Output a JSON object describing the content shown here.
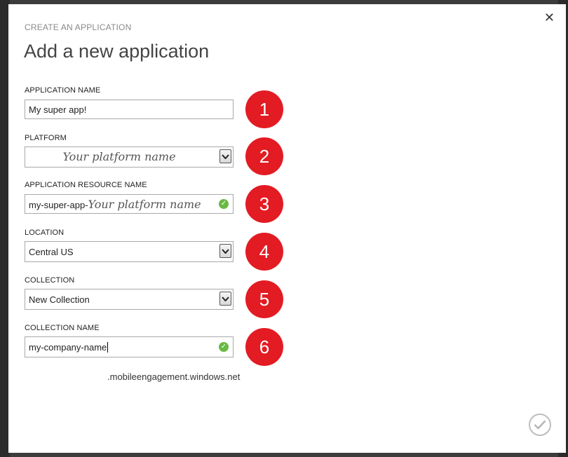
{
  "dialog": {
    "eyebrow": "CREATE AN APPLICATION",
    "title": "Add a new application",
    "close_glyph": "✕"
  },
  "fields": {
    "app_name": {
      "label": "APPLICATION NAME",
      "value": "My super app!"
    },
    "platform": {
      "label": "PLATFORM",
      "value": "Your platform name"
    },
    "resource_name": {
      "label": "APPLICATION RESOURCE NAME",
      "value_prefix": "my-super-app-",
      "value_suffix": "Your platform name"
    },
    "location": {
      "label": "LOCATION",
      "value": "Central US"
    },
    "collection": {
      "label": "COLLECTION",
      "value": "New Collection"
    },
    "collection_name": {
      "label": "COLLECTION NAME",
      "value": "my-company-name",
      "suffix": ".mobileengagement.windows.net"
    }
  },
  "steps": [
    "1",
    "2",
    "3",
    "4",
    "5",
    "6"
  ],
  "icons": {
    "close": "close-icon",
    "dropdown": "chevron-down-icon",
    "valid": "check-circle-icon",
    "confirm": "checkmark-icon"
  },
  "colors": {
    "badge": "#e31b23",
    "valid": "#69b944"
  }
}
